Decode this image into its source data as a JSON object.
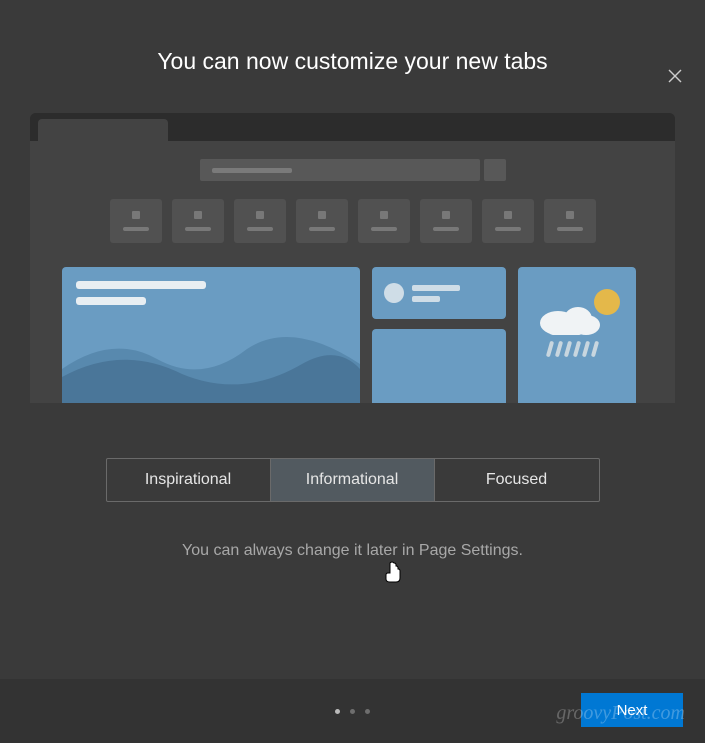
{
  "header": {
    "title": "You can now customize your new tabs"
  },
  "options": {
    "inspirational": "Inspirational",
    "informational": "Informational",
    "focused": "Focused",
    "selected": "informational"
  },
  "hint": "You can always change it later in Page Settings.",
  "footer": {
    "next_label": "Next",
    "step_current": 1,
    "step_total": 3
  },
  "watermark": "groovyPost.com"
}
